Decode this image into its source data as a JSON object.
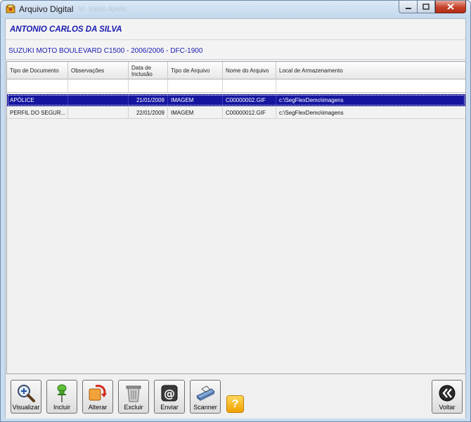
{
  "window": {
    "title": "Arquivo Digital",
    "title_ghost": "Vr. Saldo Apolic"
  },
  "header": {
    "owner_name": "ANTONIO CARLOS DA SILVA",
    "vehicle": "SUZUKI MOTO BOULEVARD C1500 - 2006/2006 - DFC-1900"
  },
  "grid": {
    "columns": [
      "Tipo de Documento",
      "Observações",
      "Data de Inclusão",
      "Tipo de Arquivo",
      "Nome do Arquivo",
      "Local de Armazenamento"
    ],
    "rows": [
      {
        "tipo_documento": "APÓLICE",
        "observacoes": "",
        "data_inclusao": "21/01/2009",
        "tipo_arquivo": "IMAGEM",
        "nome_arquivo": "C00000002.GIF",
        "local": "c:\\SegFlexDemo\\imagens"
      },
      {
        "tipo_documento": "PERFIL DO SEGUR...",
        "observacoes": "",
        "data_inclusao": "22/01/2009",
        "tipo_arquivo": "IMAGEM",
        "nome_arquivo": "C00000012.GIF",
        "local": "c:\\SegFlexDemo\\imagens"
      }
    ]
  },
  "toolbar": {
    "visualizar": "Visualizar",
    "incluir": "Incluir",
    "alterar": "Alterar",
    "excluir": "Excluir",
    "enviar": "Enviar",
    "scanner": "Scanner",
    "help": "?",
    "voltar": "Voltar"
  },
  "colors": {
    "accent_text": "#1a1ab0",
    "selection": "#15159f"
  }
}
